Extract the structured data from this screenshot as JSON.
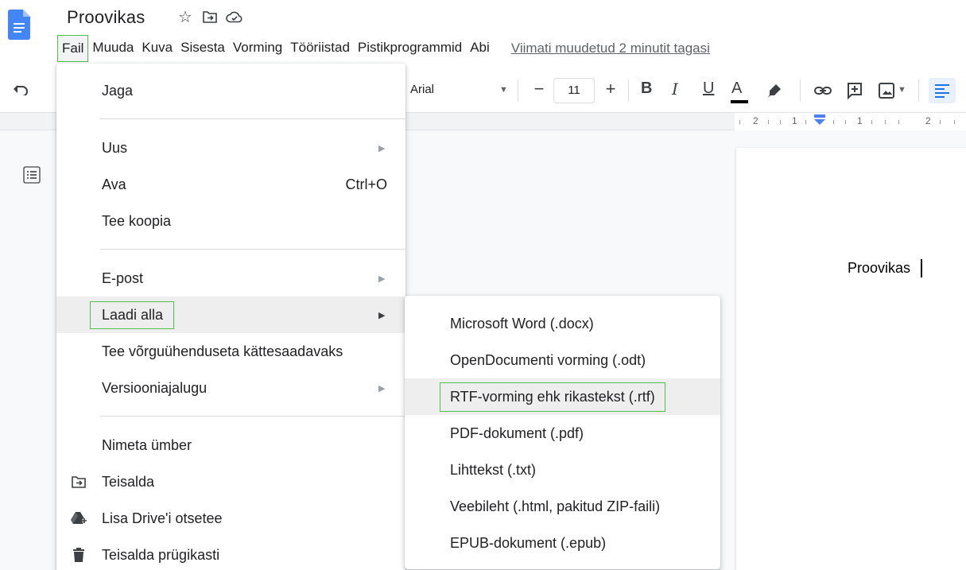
{
  "app": {
    "title": "Proovikas",
    "last_edit": "Viimati muudetud 2 minutit tagasi"
  },
  "menubar": {
    "items": [
      "Fail",
      "Muuda",
      "Kuva",
      "Sisesta",
      "Vorming",
      "Tööriistad",
      "Pistikprogrammid",
      "Abi"
    ],
    "active": "Fail"
  },
  "toolbar": {
    "font": "Arial",
    "font_size": "11",
    "minus": "−",
    "plus": "+",
    "bold": "B",
    "italic": "I",
    "underline": "U",
    "text_color": "A"
  },
  "ruler": {
    "labels": [
      "2",
      "1",
      "1",
      "2"
    ]
  },
  "file_menu": {
    "share": "Jaga",
    "new": "Uus",
    "open": "Ava",
    "open_shortcut": "Ctrl+O",
    "copy": "Tee koopia",
    "email": "E-post",
    "download": "Laadi alla",
    "offline": "Tee võrguühenduseta kättesaadavaks",
    "version_history": "Versiooniajalugu",
    "rename": "Nimeta ümber",
    "move": "Teisalda",
    "add_shortcut": "Lisa Drive'i otsetee",
    "trash": "Teisalda prügikasti"
  },
  "download_menu": {
    "items": [
      "Microsoft Word (.docx)",
      "OpenDocumenti vorming (.odt)",
      "RTF-vorming ehk rikastekst (.rtf)",
      "PDF-dokument (.pdf)",
      "Lihttekst (.txt)",
      "Veebileht (.html, pakitud ZIP-faili)",
      "EPUB-dokument (.epub)"
    ],
    "highlighted": "RTF-vorming ehk rikastekst (.rtf)"
  },
  "document": {
    "text": "Proovikas"
  },
  "colors": {
    "accent": "#1a73e8",
    "highlight_box": "#4cc14c",
    "menu_hover": "#eeeeee"
  }
}
